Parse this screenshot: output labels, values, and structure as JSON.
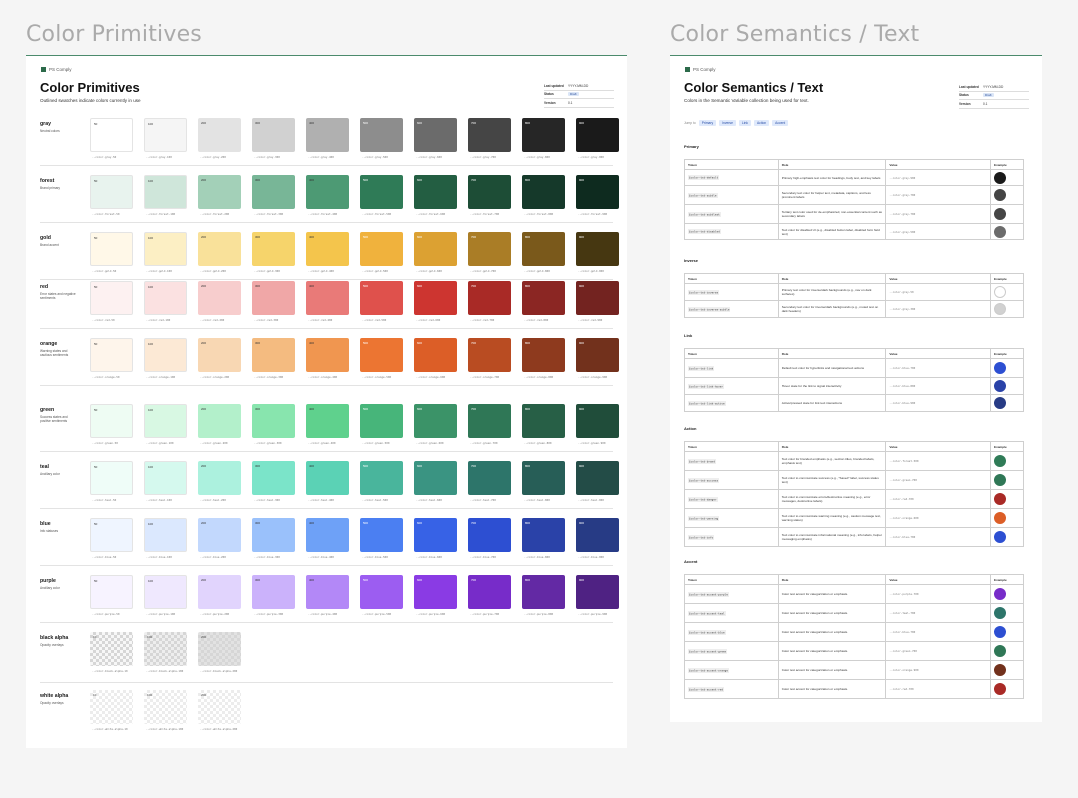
{
  "left_frame": {
    "title": "Color Primitives"
  },
  "right_frame": {
    "title": "Color Semantics / Text"
  },
  "left_sheet": {
    "brand": "PS Comply",
    "title": "Color Primitives",
    "subtitle": "Outlined swatches indicate colors currently in use",
    "meta": [
      {
        "k": "Last updated",
        "v": "YYYY-MM-DD"
      },
      {
        "k": "Status",
        "v": "Draft",
        "badge": true
      },
      {
        "k": "Version",
        "v": "0.1"
      }
    ]
  },
  "palettes": [
    {
      "name": "gray",
      "desc": "Neutral colors",
      "tokens": [
        "--color-gray-50",
        "--color-gray-100",
        "--color-gray-200",
        "--color-gray-300",
        "--color-gray-400",
        "--color-gray-500",
        "--color-gray-600",
        "--color-gray-700",
        "--color-gray-800",
        "--color-gray-900"
      ],
      "colors": [
        "#ffffff",
        "#f5f5f5",
        "#e3e3e3",
        "#d1d1d1",
        "#b0b0b0",
        "#8d8d8d",
        "#6b6b6b",
        "#454545",
        "#262626",
        "#1a1a1a"
      ]
    },
    {
      "name": "forest",
      "desc": "Brand primary",
      "tokens": [
        "--color-forest-50",
        "--color-forest-100",
        "--color-forest-200",
        "--color-forest-300",
        "--color-forest-400",
        "--color-forest-500",
        "--color-forest-600",
        "--color-forest-700",
        "--color-forest-800",
        "--color-forest-900"
      ],
      "colors": [
        "#e8f3ee",
        "#cfe6da",
        "#a3d0b8",
        "#78b697",
        "#4d9a74",
        "#2f7b57",
        "#235e42",
        "#1d4d36",
        "#15392a",
        "#0e2b1f"
      ]
    },
    {
      "name": "gold",
      "desc": "Brand accent",
      "tokens": [
        "--color-gold-50",
        "--color-gold-100",
        "--color-gold-200",
        "--color-gold-300",
        "--color-gold-400",
        "--color-gold-500",
        "--color-gold-600",
        "--color-gold-700",
        "--color-gold-800",
        "--color-gold-900"
      ],
      "colors": [
        "#fff8e8",
        "#fcefc4",
        "#f9e19a",
        "#f6d46b",
        "#f4c54c",
        "#f0b23d",
        "#dca132",
        "#aa7d26",
        "#7a591b",
        "#463711"
      ]
    },
    {
      "name": "red",
      "desc": "Error states and negative sentiments",
      "tokens": [
        "--color-red-50",
        "--color-red-100",
        "--color-red-200",
        "--color-red-300",
        "--color-red-400",
        "--color-red-500",
        "--color-red-600",
        "--color-red-700",
        "--color-red-800",
        "--color-red-900"
      ],
      "colors": [
        "#fdf1f1",
        "#fbe1e1",
        "#f7cdcd",
        "#f0a7a7",
        "#e97a78",
        "#df514c",
        "#cd3530",
        "#a92a26",
        "#8b2623",
        "#732320"
      ]
    },
    {
      "name": "orange",
      "desc": "Warning states and cautious sentiments",
      "tokens": [
        "--color-orange-50",
        "--color-orange-100",
        "--color-orange-200",
        "--color-orange-300",
        "--color-orange-400",
        "--color-orange-500",
        "--color-orange-600",
        "--color-orange-700",
        "--color-orange-800",
        "--color-orange-900"
      ],
      "colors": [
        "#fef5eb",
        "#fce9d5",
        "#f8d7b3",
        "#f4bb80",
        "#f09650",
        "#ec7532",
        "#dc5e27",
        "#b94c22",
        "#8e3a1e",
        "#72311c"
      ]
    },
    {
      "name": "green",
      "desc": "Success states and positive sentiments",
      "tokens": [
        "--color-green-50",
        "--color-green-100",
        "--color-green-200",
        "--color-green-300",
        "--color-green-400",
        "--color-green-500",
        "--color-green-600",
        "--color-green-700",
        "--color-green-800",
        "--color-green-900"
      ],
      "colors": [
        "#eefcf3",
        "#d8f8e3",
        "#b3f0cb",
        "#88e5ae",
        "#5fd18d",
        "#47b57a",
        "#3b9368",
        "#2f7756",
        "#275f46",
        "#204d3a"
      ]
    },
    {
      "name": "teal",
      "desc": "Ancillary color",
      "tokens": [
        "--color-teal-50",
        "--color-teal-100",
        "--color-teal-200",
        "--color-teal-300",
        "--color-teal-400",
        "--color-teal-500",
        "--color-teal-600",
        "--color-teal-700",
        "--color-teal-800",
        "--color-teal-900"
      ],
      "colors": [
        "#effdf8",
        "#d5f9ee",
        "#acf1de",
        "#7be4c9",
        "#5bd2b5",
        "#49b59c",
        "#3a9482",
        "#2d756a",
        "#275e57",
        "#234c47"
      ]
    },
    {
      "name": "blue",
      "desc": "Info statuses",
      "tokens": [
        "--color-blue-50",
        "--color-blue-100",
        "--color-blue-200",
        "--color-blue-300",
        "--color-blue-400",
        "--color-blue-500",
        "--color-blue-600",
        "--color-blue-700",
        "--color-blue-800",
        "--color-blue-900"
      ],
      "colors": [
        "#eff5ff",
        "#dbe8fe",
        "#c2d8fd",
        "#9ac1fb",
        "#6ea1f7",
        "#4b7ff2",
        "#3762e6",
        "#2d4fd2",
        "#2a42a8",
        "#273b85"
      ]
    },
    {
      "name": "purple",
      "desc": "Ancillary color",
      "tokens": [
        "--color-purple-50",
        "--color-purple-100",
        "--color-purple-200",
        "--color-purple-300",
        "--color-purple-400",
        "--color-purple-500",
        "--color-purple-600",
        "--color-purple-700",
        "--color-purple-800",
        "--color-purple-900"
      ],
      "colors": [
        "#f7f3ff",
        "#efe8fe",
        "#e1d4fd",
        "#cbb2fb",
        "#b388f7",
        "#9c5df1",
        "#8a3be4",
        "#772cc9",
        "#6329a4",
        "#4f2283"
      ]
    }
  ],
  "alphas": [
    {
      "name": "black alpha",
      "desc": "Opacity overlays",
      "tokens": [
        "--color-black-alpha-10",
        "--color-black-alpha-100",
        "--color-black-alpha-200"
      ],
      "labels": [
        "10",
        "100",
        "200"
      ],
      "kind": "dark"
    },
    {
      "name": "white alpha",
      "desc": "Opacity overlays",
      "tokens": [
        "--color-white-alpha-10",
        "--color-white-alpha-100",
        "--color-white-alpha-200"
      ],
      "labels": [
        "10",
        "100",
        "200"
      ],
      "kind": "light"
    }
  ],
  "right_sheet": {
    "brand": "PS Comply",
    "title": "Color Semantics / Text",
    "subtitle": "Colors in the Semantic Variable collection being used for text.",
    "meta": [
      {
        "k": "Last updated",
        "v": "YYYY-MM-DD"
      },
      {
        "k": "Status",
        "v": "Draft",
        "badge": true
      },
      {
        "k": "Version",
        "v": "0.1"
      }
    ],
    "chips_label": "Jump to",
    "chips": [
      "Primary",
      "Inverse",
      "Link",
      "Action",
      "Accent"
    ],
    "headers": {
      "token": "Token",
      "role": "Role",
      "value": "Value",
      "example": "Example"
    },
    "groups": [
      {
        "name": "Primary",
        "rows": [
          {
            "token": "$color-txt-default",
            "role": "Primary high-emphasis text color for headings, body text, and key labels",
            "value": "--color-gray-900",
            "color": "#1a1a1a"
          },
          {
            "token": "$color-txt-subtle",
            "role": "Secondary text color for helper text, metadata, captions, and less prominent labels",
            "value": "--color-gray-700",
            "color": "#454545"
          },
          {
            "token": "$color-txt-subtlest",
            "role": "Tertiary text color used for de-emphasized, non-essential content such as secondary labels",
            "value": "--color-gray-700",
            "color": "#454545"
          },
          {
            "token": "$color-txt-disabled",
            "role": "Text color for disabled UI (e.g., disabled button label, disabled form field text)",
            "value": "--color-gray-500",
            "color": "#6b6b6b"
          }
        ]
      },
      {
        "name": "Inverse",
        "rows": [
          {
            "token": "$color-txt-inverse",
            "role": "Primary text color for inverse/dark backgrounds (e.g., nav on dark surfaces)",
            "value": "--color-gray-50",
            "color": "#ffffff"
          },
          {
            "token": "$color-txt-inverse-subtle",
            "role": "Secondary text color for inverse/dark backgrounds (e.g., muted text on dark headers)",
            "value": "--color-gray-300",
            "color": "#d1d1d1"
          }
        ]
      },
      {
        "name": "Link",
        "rows": [
          {
            "token": "$color-txt-link",
            "role": "Default text color for hyperlinks and navigational text actions",
            "value": "--color-blue-700",
            "color": "#2d4fd2"
          },
          {
            "token": "$color-txt-link-hover",
            "role": "Hover state for the link to signal interactivity",
            "value": "--color-blue-800",
            "color": "#2a42a8"
          },
          {
            "token": "$color-txt-link-active",
            "role": "Active/pressed state for link text interactions",
            "value": "--color-blue-900",
            "color": "#273b85"
          }
        ]
      },
      {
        "name": "Action",
        "rows": [
          {
            "token": "$color-txt-brand",
            "role": "Text color for branded emphasis (e.g., section titles, branded labels, emphasis text)",
            "value": "--color-forest-500",
            "color": "#2f7b57"
          },
          {
            "token": "$color-txt-success",
            "role": "Text color to communicate success (e.g., \"Saved\" label, success status text)",
            "value": "--color-green-700",
            "color": "#2f7756"
          },
          {
            "token": "$color-txt-danger",
            "role": "Text color to communicate errors/destructive meaning (e.g., error messages, destructive labels)",
            "value": "--color-red-700",
            "color": "#a92a26"
          },
          {
            "token": "$color-txt-warning",
            "role": "Text color to communicate warning meaning (e.g., caution message text, warning status)",
            "value": "--color-orange-600",
            "color": "#dc5e27"
          },
          {
            "token": "$color-txt-info",
            "role": "Text color to communicate informational meaning (e.g., info labels, helper messaging emphasis)",
            "value": "--color-blue-700",
            "color": "#2d4fd2"
          }
        ]
      },
      {
        "name": "Accent",
        "rows": [
          {
            "token": "$color-txt-accent-purple",
            "role": "Color text accent for categorization or emphasis.",
            "value": "--color-purple-700",
            "color": "#772cc9"
          },
          {
            "token": "$color-txt-accent-teal",
            "role": "Color text accent for categorization or emphasis.",
            "value": "--color-teal-700",
            "color": "#2d756a"
          },
          {
            "token": "$color-txt-accent-blue",
            "role": "Color text accent for categorization or emphasis.",
            "value": "--color-blue-700",
            "color": "#2d4fd2"
          },
          {
            "token": "$color-txt-accent-green",
            "role": "Color text accent for categorization or emphasis.",
            "value": "--color-green-700",
            "color": "#2f7756"
          },
          {
            "token": "$color-txt-accent-orange",
            "role": "Color text accent for categorization or emphasis.",
            "value": "--color-orange-900",
            "color": "#72311c"
          },
          {
            "token": "$color-txt-accent-red",
            "role": "Color text accent for categorization or emphasis.",
            "value": "--color-red-700",
            "color": "#a92a26"
          }
        ]
      }
    ]
  }
}
